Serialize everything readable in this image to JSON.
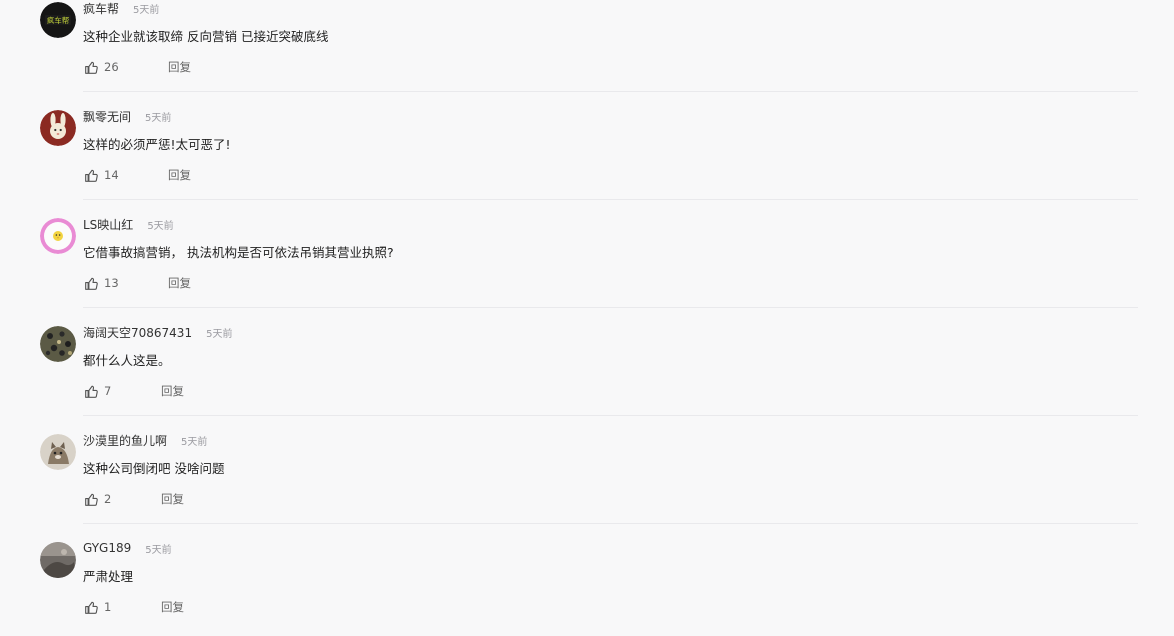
{
  "colors": {
    "background": "#f8f8f9",
    "text": "#222222",
    "meta": "#9a9aa0",
    "action": "#666666",
    "divider": "#e9e9ec"
  },
  "comments": [
    {
      "username": "疯车帮",
      "time": "5天前",
      "text": "这种企业就该取缔 反向营销 已接近突破底线",
      "likes": "26",
      "reply_label": "回复",
      "avatar": "logo-avatar",
      "avatar_text": "疯车帮"
    },
    {
      "username": "飘零无间",
      "time": "5天前",
      "text": "这样的必须严惩!太可恶了!",
      "likes": "14",
      "reply_label": "回复",
      "avatar": "rabbit-avatar"
    },
    {
      "username": "LS映山红",
      "time": "5天前",
      "text": "它借事故搞营销， 执法机构是否可依法吊销其营业执照?",
      "likes": "13",
      "reply_label": "回复",
      "avatar": "chick-avatar"
    },
    {
      "username": "海阔天空70867431",
      "time": "5天前",
      "text": "都什么人这是。",
      "likes": "7",
      "reply_label": "回复",
      "avatar": "leopard-avatar"
    },
    {
      "username": "沙漠里的鱼儿啊",
      "time": "5天前",
      "text": "这种公司倒闭吧 没啥问题",
      "likes": "2",
      "reply_label": "回复",
      "avatar": "cat-avatar"
    },
    {
      "username": "GYG189",
      "time": "5天前",
      "text": "严肃处理",
      "likes": "1",
      "reply_label": "回复",
      "avatar": "photo-avatar"
    }
  ]
}
